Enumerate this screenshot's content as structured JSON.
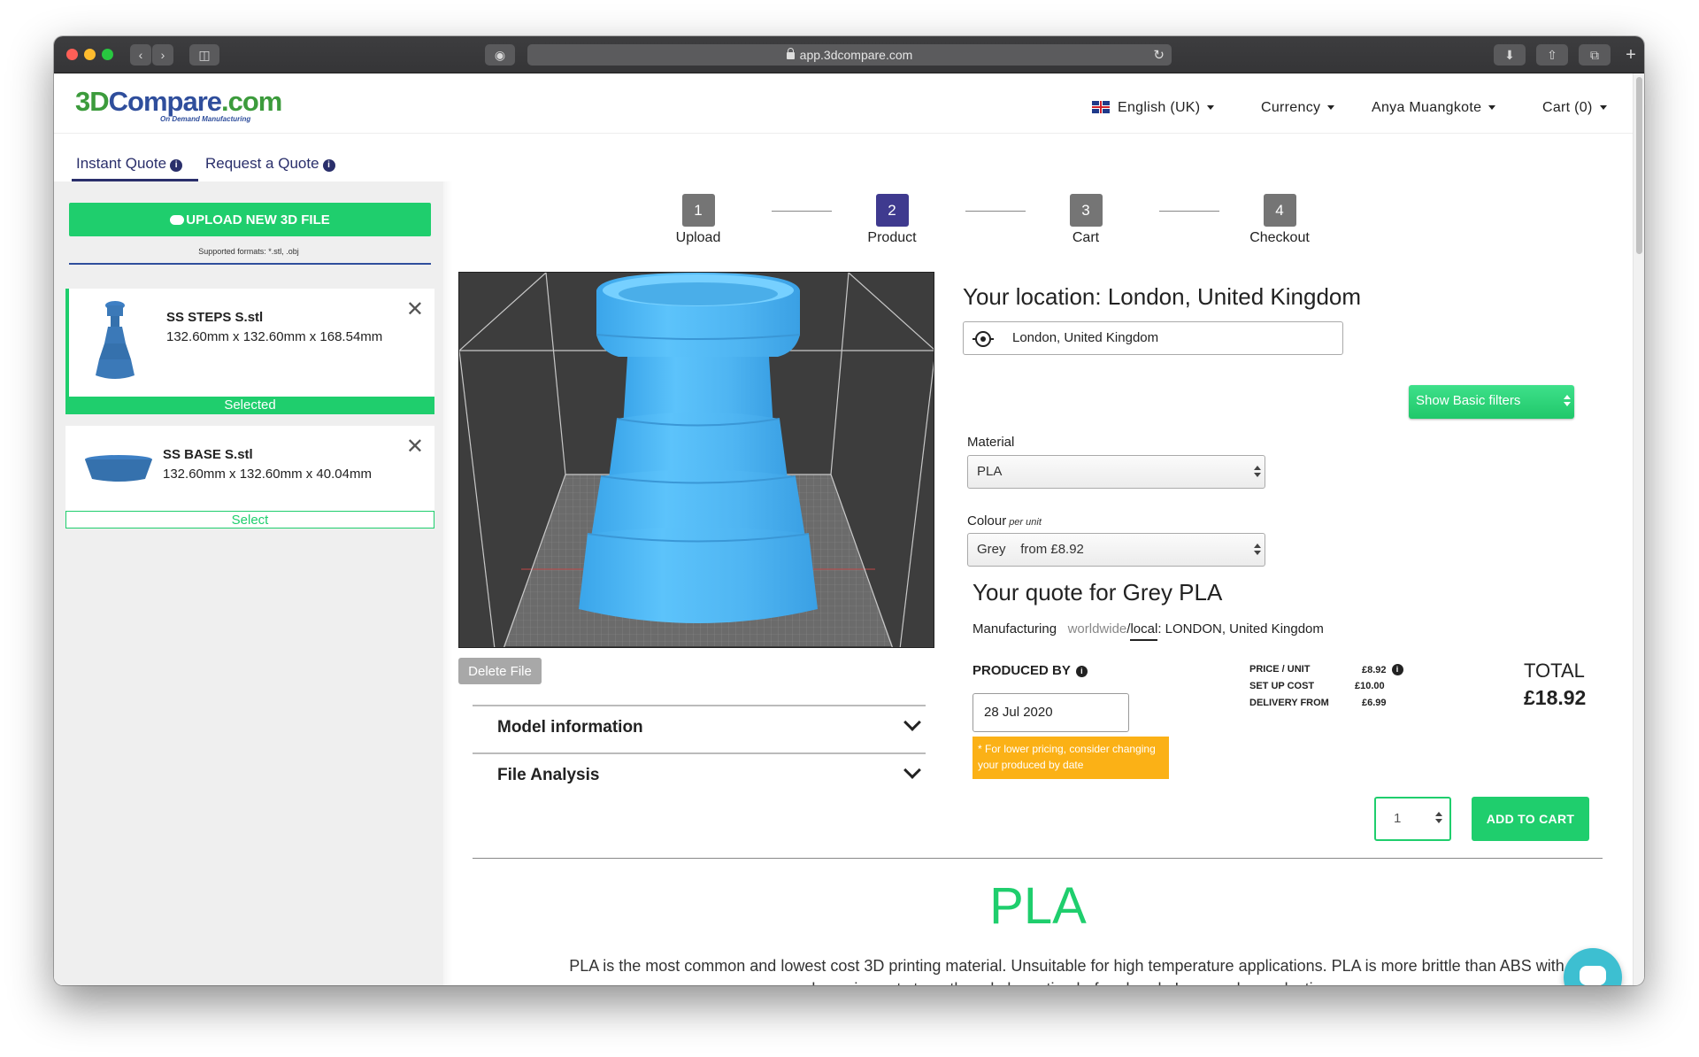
{
  "browser": {
    "url": "app.3dcompare.com"
  },
  "header": {
    "logo_part1": "3D",
    "logo_part2": "Compare",
    "logo_part3": ".com",
    "logo_sub": "On Demand Manufacturing",
    "language": "English (UK)",
    "currency": "Currency",
    "user": "Anya Muangkote",
    "cart": "Cart (0)"
  },
  "tabs": [
    {
      "label": "Instant Quote"
    },
    {
      "label": "Request a Quote"
    }
  ],
  "sidebar": {
    "upload_label": "UPLOAD NEW 3D FILE",
    "formats": "Supported formats: *.stl, .obj",
    "files": [
      {
        "name": "SS STEPS S.stl",
        "dims": "132.60mm x 132.60mm x 168.54mm",
        "status": "Selected"
      },
      {
        "name": "SS BASE S.stl",
        "dims": "132.60mm x 132.60mm x 40.04mm",
        "status": "Select"
      }
    ]
  },
  "steps": [
    {
      "num": "1",
      "label": "Upload"
    },
    {
      "num": "2",
      "label": "Product"
    },
    {
      "num": "3",
      "label": "Cart"
    },
    {
      "num": "4",
      "label": "Checkout"
    }
  ],
  "viewer": {
    "delete_label": "Delete File"
  },
  "accordion": [
    {
      "title": "Model information"
    },
    {
      "title": "File Analysis"
    }
  ],
  "location": {
    "title": "Your location: London, United Kingdom",
    "value": "London, United Kingdom"
  },
  "material": {
    "label": "Material",
    "value": "PLA",
    "filters_label": "Show Basic filters"
  },
  "colour": {
    "label": "Colour",
    "sublabel": "per unit",
    "value": "Grey",
    "price": "from £8.92"
  },
  "quote": {
    "title": "Your quote for Grey PLA",
    "mfg_label": "Manufacturing",
    "mfg_worldwide": "worldwide",
    "mfg_sep": "/",
    "mfg_local": "local",
    "mfg_location": ": LONDON, United Kingdom",
    "produced_by_label": "PRODUCED BY",
    "produced_by_date": "28 Jul 2020",
    "hint": "* For lower pricing, consider changing your produced by date",
    "price_unit_label": "PRICE / UNIT",
    "price_unit": "£8.92",
    "setup_label": "SET UP COST",
    "setup": "£10.00",
    "delivery_label": "DELIVERY FROM",
    "delivery": "£6.99",
    "total_label": "TOTAL",
    "total": "£18.92",
    "quantity": "1",
    "add_to_cart": "ADD TO CART"
  },
  "material_info": {
    "title": "PLA",
    "description": "PLA is the most common and lowest cost 3D printing material. Unsuitable for high temperature applications. PLA is more brittle than ABS with a lower impact strength and elongation before break. Large colour selection."
  },
  "colors": {
    "accent_green": "#1fce6d",
    "brand_navy": "#2a2f6b",
    "step_active": "#3f3a8f",
    "hint_orange": "#fbb116",
    "model_blue": "#4fb5f2"
  }
}
